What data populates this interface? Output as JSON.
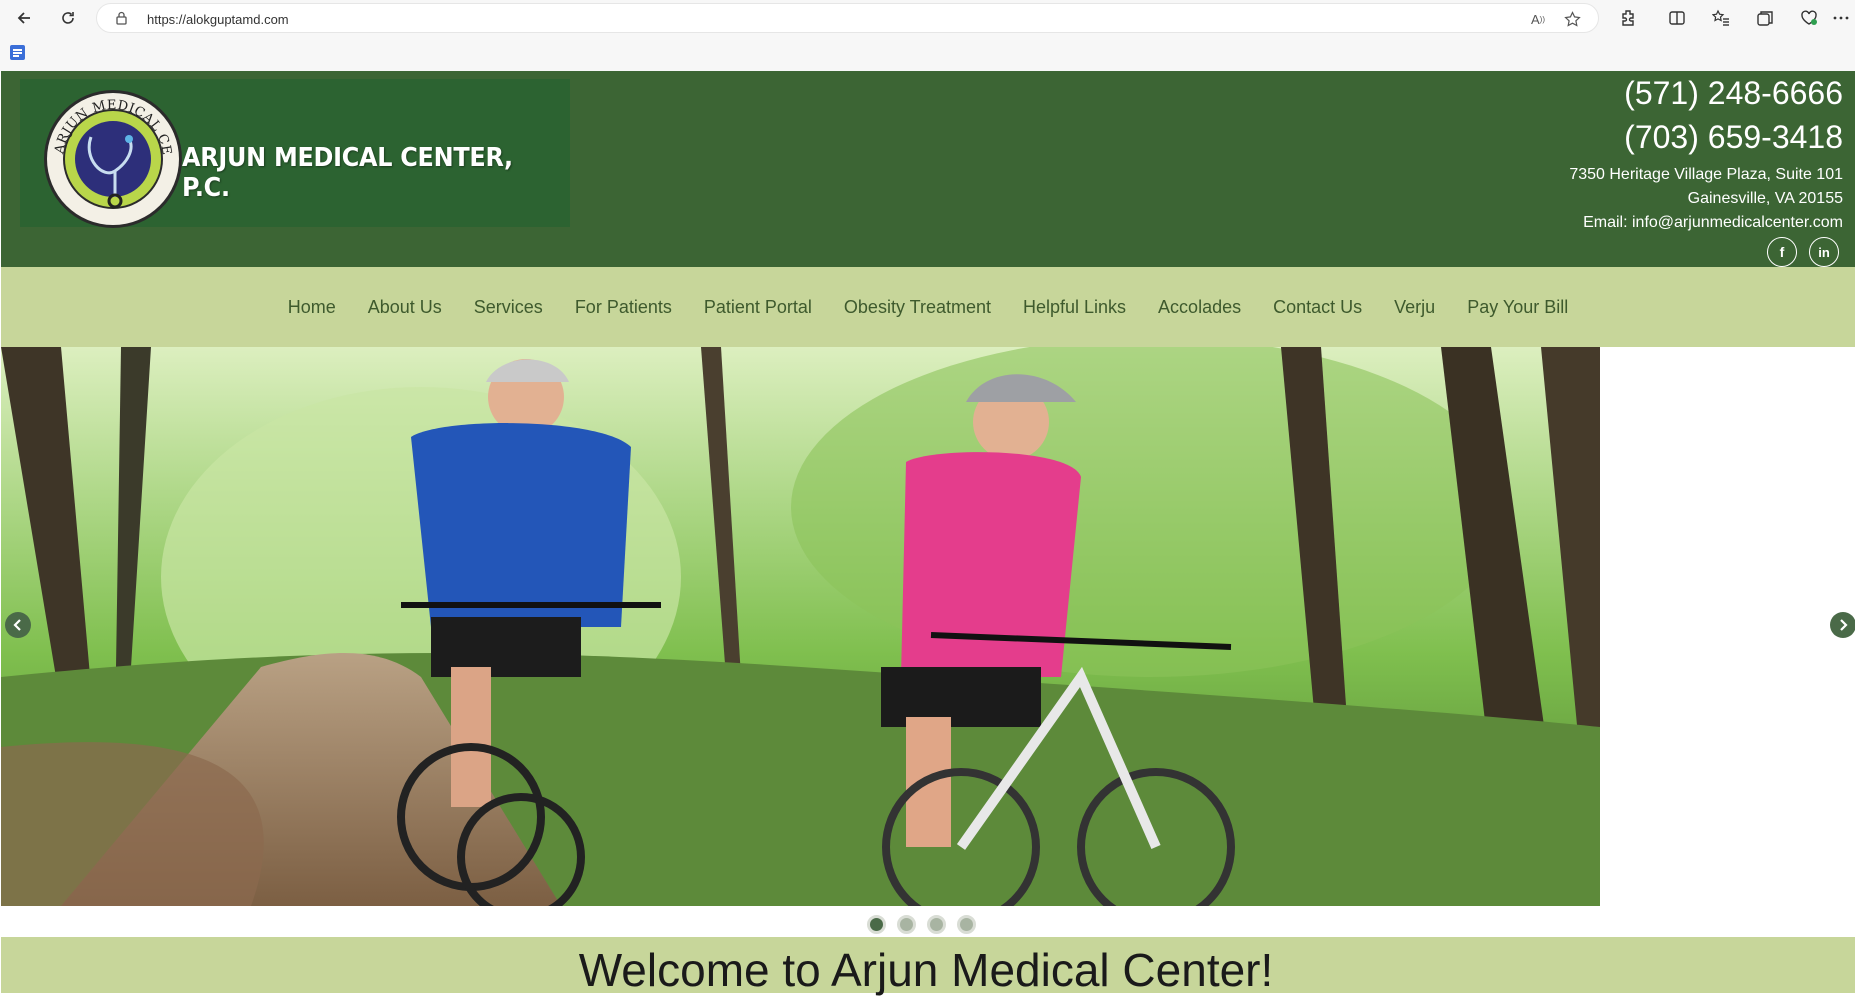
{
  "browser": {
    "url": "https://alokguptamd.com"
  },
  "header": {
    "logo_text": "ARJUN MEDICAL CENTER, P.C.",
    "brand_name": "ARJUN MEDICAL CENTER, P.C.",
    "phone_1": "(571) 248-6666",
    "phone_2": "(703) 659-3418",
    "address_line_1": "7350 Heritage Village Plaza, Suite 101",
    "address_line_2": "Gainesville, VA 20155",
    "email": "Email: info@arjunmedicalcenter.com",
    "social": [
      {
        "icon": "facebook-icon",
        "label": "f"
      },
      {
        "icon": "linkedin-icon",
        "label": "in"
      }
    ]
  },
  "nav": {
    "items": [
      {
        "label": "Home"
      },
      {
        "label": "About Us"
      },
      {
        "label": "Services"
      },
      {
        "label": "For Patients"
      },
      {
        "label": "Patient Portal"
      },
      {
        "label": "Obesity Treatment"
      },
      {
        "label": "Helpful Links"
      },
      {
        "label": "Accolades"
      },
      {
        "label": "Contact Us"
      },
      {
        "label": "Verju"
      },
      {
        "label": "Pay Your Bill"
      }
    ]
  },
  "slider": {
    "slide_count": 4,
    "active_slide": 1
  },
  "welcome": {
    "title": "Welcome to Arjun Medical Center!"
  },
  "colors": {
    "header_green": "#3c6534",
    "nav_bg": "#c7d69a",
    "nav_text": "#3e5a2d"
  }
}
